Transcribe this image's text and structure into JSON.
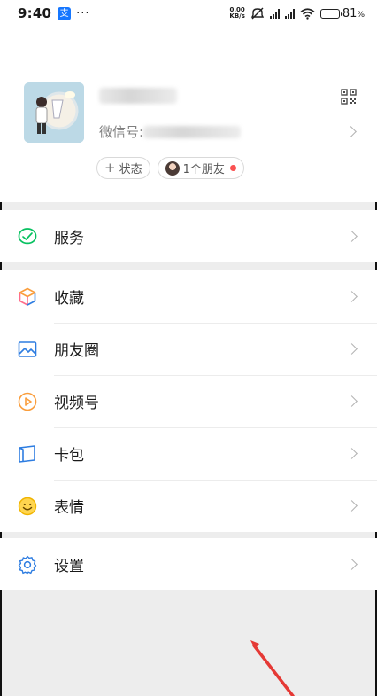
{
  "status_bar": {
    "time": "9:40",
    "app_badge": "支",
    "more": "···",
    "net_speed_value": "0.00",
    "net_speed_unit": "KB/s",
    "battery_percent": "81",
    "battery_suffix": "%",
    "battery_level": 0.81
  },
  "profile": {
    "wechat_id_label": "微信号: ",
    "status_chip": "状态",
    "friends_chip": "1个朋友"
  },
  "menu": {
    "services": "服务",
    "favorites": "收藏",
    "moments": "朋友圈",
    "channels": "视频号",
    "cards": "卡包",
    "stickers": "表情",
    "settings": "设置"
  },
  "colors": {
    "accent_green": "#07c160",
    "annotation_red": "#e53935",
    "background": "#ededed"
  }
}
